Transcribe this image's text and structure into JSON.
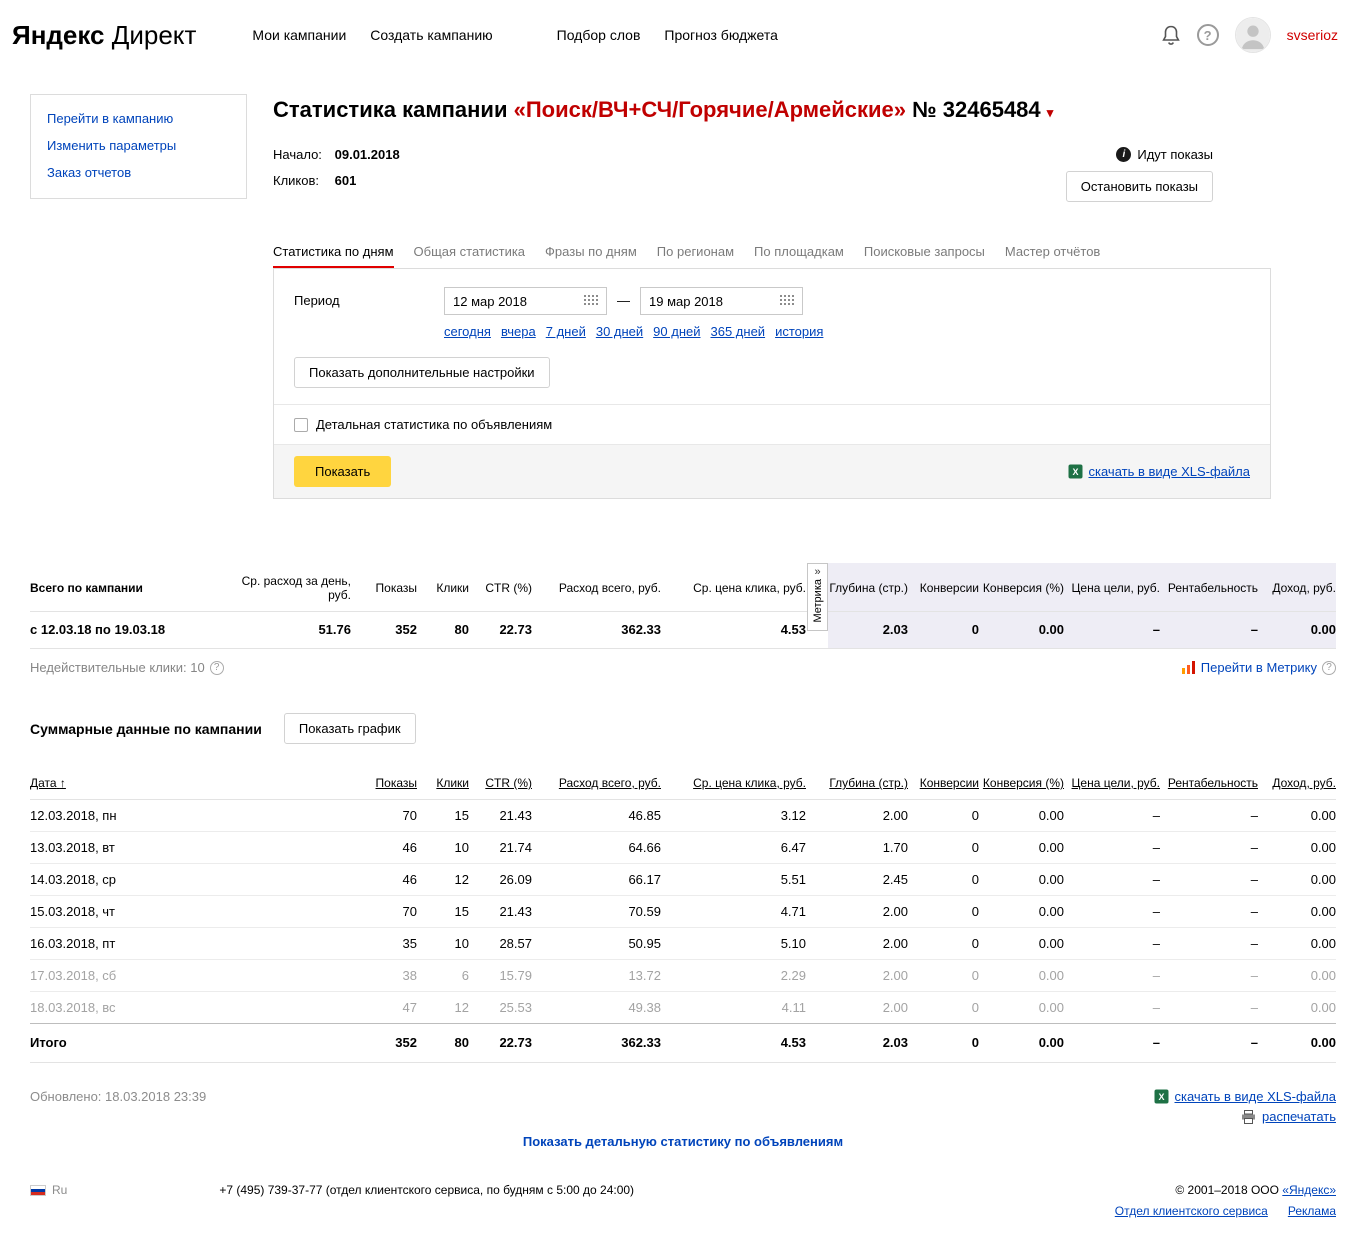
{
  "header": {
    "logo_bold": "Яндекс",
    "logo_rest": "Директ",
    "nav": [
      "Мои кампании",
      "Создать кампанию",
      "Подбор слов",
      "Прогноз бюджета"
    ],
    "username": "svserioz"
  },
  "sidebar": {
    "items": [
      "Перейти в кампанию",
      "Изменить параметры",
      "Заказ отчетов"
    ]
  },
  "campaign": {
    "title_prefix": "Статистика кампании",
    "title_name": "«Поиск/ВЧ+СЧ/Горячие/Армейские»",
    "title_number": "№ 32465484",
    "title_caret": "▾",
    "start_label": "Начало:",
    "start_value": "09.01.2018",
    "clicks_label": "Кликов:",
    "clicks_value": "601",
    "status_text": "Идут показы",
    "stop_button": "Остановить показы"
  },
  "tabs": [
    "Статистика по дням",
    "Общая статистика",
    "Фразы по дням",
    "По регионам",
    "По площадкам",
    "Поисковые запросы",
    "Мастер отчётов"
  ],
  "filter": {
    "period_label": "Период",
    "date_from": "12 мар 2018",
    "date_to": "19 мар 2018",
    "dash": "—",
    "quick_links": [
      "сегодня",
      "вчера",
      "7 дней",
      "30 дней",
      "90 дней",
      "365 дней",
      "история"
    ],
    "advanced_button": "Показать дополнительные настройки",
    "detail_checkbox_label": "Детальная статистика по объявлениям",
    "show_button": "Показать",
    "xls_link": "скачать в виде XLS-файла"
  },
  "totals_table": {
    "columns": [
      "Всего по кампании",
      "Ср. расход за день, руб.",
      "Показы",
      "Клики",
      "CTR (%)",
      "Расход всего, руб.",
      "Ср. цена клика, руб.",
      "Глубина (стр.)",
      "Конверсии",
      "Конверсия (%)",
      "Цена цели, руб.",
      "Рентабельность",
      "Доход, руб."
    ],
    "metrika_label": "Метрика",
    "metrika_arrow": "»",
    "row": {
      "label": "с 12.03.18 по 19.03.18",
      "values": [
        "51.76",
        "352",
        "80",
        "22.73",
        "362.33",
        "4.53",
        "2.03",
        "0",
        "0.00",
        "–",
        "–",
        "0.00"
      ]
    },
    "invalid_clicks": "Недействительные клики: 10",
    "metrika_link": "Перейти в Метрику"
  },
  "summary": {
    "heading": "Суммарные данные по кампании",
    "chart_button": "Показать график"
  },
  "daily_table": {
    "columns": [
      "Дата",
      "Показы",
      "Клики",
      "CTR (%)",
      "Расход всего, руб.",
      "Ср. цена клика, руб.",
      "Глубина (стр.)",
      "Конверсии",
      "Конверсия (%)",
      "Цена цели, руб.",
      "Рентабельность",
      "Доход, руб."
    ],
    "sort_arrow": "↑",
    "rows": [
      {
        "date": "12.03.2018, пн",
        "muted": false,
        "values": [
          "70",
          "15",
          "21.43",
          "46.85",
          "3.12",
          "2.00",
          "0",
          "0.00",
          "–",
          "–",
          "0.00"
        ]
      },
      {
        "date": "13.03.2018, вт",
        "muted": false,
        "values": [
          "46",
          "10",
          "21.74",
          "64.66",
          "6.47",
          "1.70",
          "0",
          "0.00",
          "–",
          "–",
          "0.00"
        ]
      },
      {
        "date": "14.03.2018, ср",
        "muted": false,
        "values": [
          "46",
          "12",
          "26.09",
          "66.17",
          "5.51",
          "2.45",
          "0",
          "0.00",
          "–",
          "–",
          "0.00"
        ]
      },
      {
        "date": "15.03.2018, чт",
        "muted": false,
        "values": [
          "70",
          "15",
          "21.43",
          "70.59",
          "4.71",
          "2.00",
          "0",
          "0.00",
          "–",
          "–",
          "0.00"
        ]
      },
      {
        "date": "16.03.2018, пт",
        "muted": false,
        "values": [
          "35",
          "10",
          "28.57",
          "50.95",
          "5.10",
          "2.00",
          "0",
          "0.00",
          "–",
          "–",
          "0.00"
        ]
      },
      {
        "date": "17.03.2018, сб",
        "muted": true,
        "values": [
          "38",
          "6",
          "15.79",
          "13.72",
          "2.29",
          "2.00",
          "0",
          "0.00",
          "–",
          "–",
          "0.00"
        ]
      },
      {
        "date": "18.03.2018, вс",
        "muted": true,
        "values": [
          "47",
          "12",
          "25.53",
          "49.38",
          "4.11",
          "2.00",
          "0",
          "0.00",
          "–",
          "–",
          "0.00"
        ]
      }
    ],
    "total_row": {
      "label": "Итого",
      "values": [
        "352",
        "80",
        "22.73",
        "362.33",
        "4.53",
        "2.03",
        "0",
        "0.00",
        "–",
        "–",
        "0.00"
      ]
    }
  },
  "bottom": {
    "updated": "Обновлено: 18.03.2018 23:39",
    "xls_link": "скачать в виде XLS-файла",
    "print_link": "распечатать",
    "detail_link": "Показать детальную статистику по объявлениям"
  },
  "page_footer": {
    "lang": "Ru",
    "phone": "+7 (495) 739-37-77 (отдел клиентского сервиса, по будням с 5:00 до 24:00)",
    "copyright_prefix": "© 2001–2018  ООО ",
    "copyright_link": "«Яндекс»",
    "links": [
      "Отдел клиентского сервиса",
      "Реклама"
    ]
  }
}
